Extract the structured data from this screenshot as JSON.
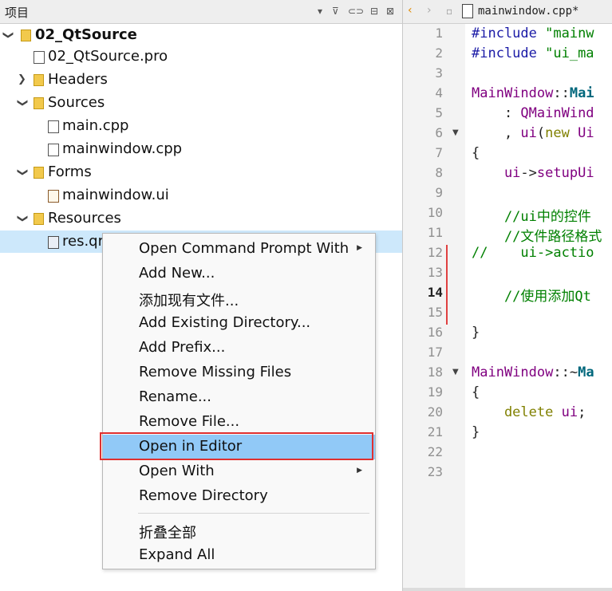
{
  "project_panel": {
    "title": "项目",
    "tree": [
      {
        "label": "02_QtSource",
        "depth": 0,
        "expanded": true,
        "bold": true,
        "icon": "qt-project-icon"
      },
      {
        "label": "02_QtSource.pro",
        "depth": 1,
        "icon": "pro-file-icon"
      },
      {
        "label": "Headers",
        "depth": 1,
        "expanded": false,
        "icon": "folder-icon"
      },
      {
        "label": "Sources",
        "depth": 1,
        "expanded": true,
        "icon": "folder-icon"
      },
      {
        "label": "main.cpp",
        "depth": 2,
        "icon": "file-icon"
      },
      {
        "label": "mainwindow.cpp",
        "depth": 2,
        "icon": "file-icon"
      },
      {
        "label": "Forms",
        "depth": 1,
        "expanded": true,
        "icon": "folder-icon"
      },
      {
        "label": "mainwindow.ui",
        "depth": 2,
        "icon": "ui-file-icon"
      },
      {
        "label": "Resources",
        "depth": 1,
        "expanded": true,
        "icon": "folder-icon"
      },
      {
        "label": "res.qrc",
        "depth": 2,
        "icon": "qrc-file-icon",
        "selected": true
      }
    ]
  },
  "editor": {
    "filename": "mainwindow.cpp*",
    "current_line": 14,
    "lines": [
      {
        "n": "1",
        "parts": [
          [
            "pp",
            "#include "
          ],
          [
            "str",
            "\"mainw"
          ]
        ]
      },
      {
        "n": "2",
        "parts": [
          [
            "pp",
            "#include "
          ],
          [
            "str",
            "\"ui_ma"
          ]
        ]
      },
      {
        "n": "3",
        "parts": []
      },
      {
        "n": "4",
        "parts": [
          [
            "cls",
            "MainWindow"
          ],
          [
            "dk",
            "::"
          ],
          [
            "fn",
            "Mai"
          ]
        ]
      },
      {
        "n": "5",
        "parts": [
          [
            "dk",
            "    : "
          ],
          [
            "cls",
            "QMainWind"
          ]
        ]
      },
      {
        "n": "6",
        "parts": [
          [
            "dk",
            "    , "
          ],
          [
            "cls",
            "ui"
          ],
          [
            "dk",
            "("
          ],
          [
            "kw",
            "new "
          ],
          [
            "cls",
            "Ui"
          ]
        ]
      },
      {
        "n": "7",
        "parts": [
          [
            "dk",
            "{"
          ]
        ]
      },
      {
        "n": "8",
        "parts": [
          [
            "cls",
            "    ui"
          ],
          [
            "dk",
            "->"
          ],
          [
            "fn2",
            "setupUi"
          ]
        ]
      },
      {
        "n": "9",
        "parts": []
      },
      {
        "n": "10",
        "parts": [
          [
            "cm",
            "    //ui中的控件"
          ]
        ]
      },
      {
        "n": "11",
        "parts": [
          [
            "cm",
            "    //文件路径格式"
          ]
        ]
      },
      {
        "n": "12",
        "parts": [
          [
            "cm",
            "//    ui->actio"
          ]
        ]
      },
      {
        "n": "13",
        "parts": []
      },
      {
        "n": "14",
        "parts": [
          [
            "cm",
            "    //使用添加Qt"
          ]
        ]
      },
      {
        "n": "15",
        "parts": []
      },
      {
        "n": "16",
        "parts": [
          [
            "dk",
            "}"
          ]
        ]
      },
      {
        "n": "17",
        "parts": []
      },
      {
        "n": "18",
        "parts": [
          [
            "cls",
            "MainWindow"
          ],
          [
            "dk",
            "::~"
          ],
          [
            "fn",
            "Ma"
          ]
        ]
      },
      {
        "n": "19",
        "parts": [
          [
            "dk",
            "{"
          ]
        ]
      },
      {
        "n": "20",
        "parts": [
          [
            "kw",
            "    delete "
          ],
          [
            "cls",
            "ui"
          ],
          [
            "dk",
            ";"
          ]
        ]
      },
      {
        "n": "21",
        "parts": [
          [
            "dk",
            "}"
          ]
        ]
      },
      {
        "n": "22",
        "parts": []
      },
      {
        "n": "23",
        "parts": []
      }
    ]
  },
  "context_menu": {
    "items": [
      {
        "label": "Open Command Prompt With",
        "submenu": true
      },
      {
        "label": "Add New..."
      },
      {
        "label": "添加现有文件..."
      },
      {
        "label": "Add Existing Directory..."
      },
      {
        "label": "Add Prefix..."
      },
      {
        "label": "Remove Missing Files"
      },
      {
        "label": "Rename..."
      },
      {
        "label": "Remove File..."
      },
      {
        "label": "Open in Editor",
        "highlighted": true
      },
      {
        "label": "Open With",
        "submenu": true
      },
      {
        "label": "Remove Directory"
      },
      {
        "separator": true
      },
      {
        "label": "折叠全部"
      },
      {
        "label": "Expand All"
      }
    ]
  },
  "colors": {
    "selection": "#cde8fb",
    "menu_highlight": "#91c9f7",
    "annotation_box": "#e03030"
  }
}
